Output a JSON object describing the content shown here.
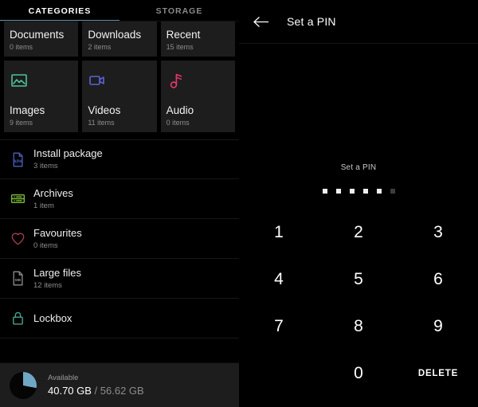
{
  "file_manager": {
    "tabs": [
      {
        "label": "CATEGORIES",
        "active": true
      },
      {
        "label": "STORAGE",
        "active": false
      }
    ],
    "category_cards": [
      {
        "title": "Documents",
        "subtitle": "0 items",
        "icon": "document-icon",
        "icon_color": "#6fd3a8",
        "tall": false
      },
      {
        "title": "Downloads",
        "subtitle": "2 items",
        "icon": "download-icon",
        "icon_color": "#7c8ee0",
        "tall": false
      },
      {
        "title": "Recent",
        "subtitle": "15 items",
        "icon": "clock-icon",
        "icon_color": "#e0607f",
        "tall": false
      },
      {
        "title": "Images",
        "subtitle": "9 items",
        "icon": "image-icon",
        "icon_color": "#4cc49a",
        "tall": true
      },
      {
        "title": "Videos",
        "subtitle": "11 items",
        "icon": "video-icon",
        "icon_color": "#5a64d6",
        "tall": true
      },
      {
        "title": "Audio",
        "subtitle": "0 items",
        "icon": "music-note-icon",
        "icon_color": "#e23a6b",
        "tall": true
      }
    ],
    "list_items": [
      {
        "title": "Install package",
        "subtitle": "3 items",
        "icon": "apk-file-icon",
        "icon_color": "#4a5fc1"
      },
      {
        "title": "Archives",
        "subtitle": "1 item",
        "icon": "archive-icon",
        "icon_color": "#7aba3c"
      },
      {
        "title": "Favourites",
        "subtitle": "0 items",
        "icon": "heart-icon",
        "icon_color": "#a33a4a"
      },
      {
        "title": "Large files",
        "subtitle": "12 items",
        "icon": "large-file-icon",
        "icon_color": "#8d8d8d"
      },
      {
        "title": "Lockbox",
        "subtitle": "",
        "icon": "lock-icon",
        "icon_color": "#49a08d"
      }
    ],
    "storage": {
      "label": "Available",
      "used_value": "40.70 GB",
      "separator": " / ",
      "total_value": "56.62 GB",
      "pie_fill_color": "#6ea8c6",
      "pie_empty_color": "#050505",
      "pie_used_percent": 28
    }
  },
  "pin_screen": {
    "header_title": "Set a PIN",
    "back_icon": "arrow-left-icon",
    "prompt": "Set a PIN",
    "dots": [
      {
        "filled": true
      },
      {
        "filled": true
      },
      {
        "filled": true
      },
      {
        "filled": true
      },
      {
        "filled": true
      },
      {
        "filled": false
      }
    ],
    "keys": [
      {
        "label": "1",
        "type": "digit"
      },
      {
        "label": "2",
        "type": "digit"
      },
      {
        "label": "3",
        "type": "digit"
      },
      {
        "label": "4",
        "type": "digit"
      },
      {
        "label": "5",
        "type": "digit"
      },
      {
        "label": "6",
        "type": "digit"
      },
      {
        "label": "7",
        "type": "digit"
      },
      {
        "label": "8",
        "type": "digit"
      },
      {
        "label": "9",
        "type": "digit"
      },
      {
        "label": "",
        "type": "blank"
      },
      {
        "label": "0",
        "type": "digit"
      },
      {
        "label": "DELETE",
        "type": "delete"
      }
    ]
  }
}
